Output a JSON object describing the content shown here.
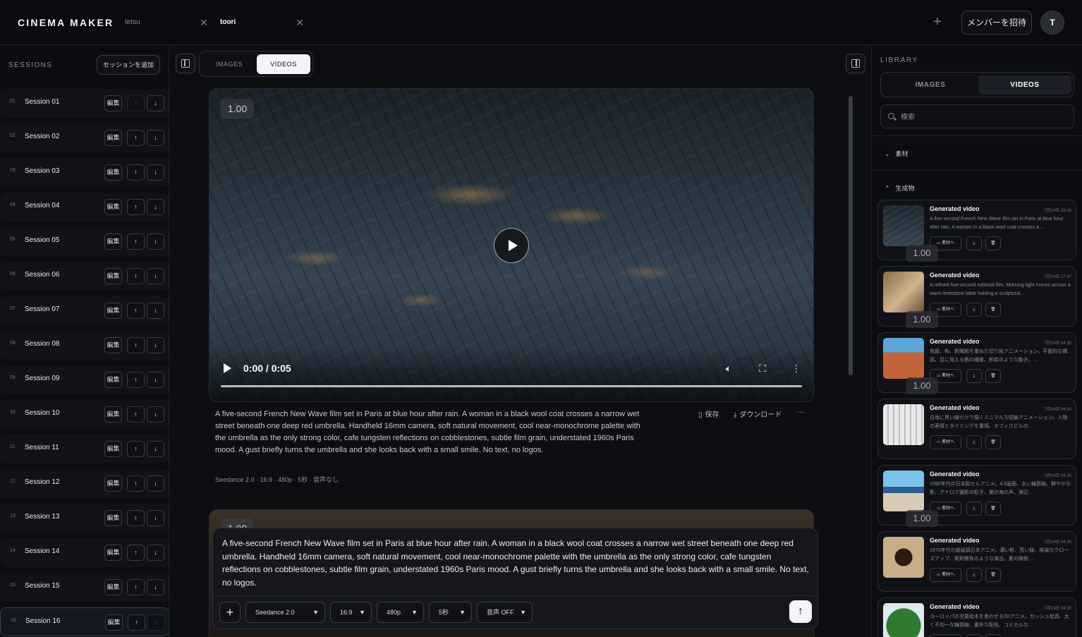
{
  "app": {
    "brand": "CINEMA MAKER",
    "tabs": [
      {
        "label": "tetsu"
      },
      {
        "label": "toori"
      }
    ],
    "invite_label": "メンバーを招待",
    "avatar_initial": "T"
  },
  "sessions": {
    "title": "SESSIONS",
    "add_label": "セッションを追加",
    "edit_label": "編集",
    "up_label": "↑",
    "down_label": "↓",
    "items": [
      {
        "num": "01",
        "name": "Session 01"
      },
      {
        "num": "02",
        "name": "Session 02"
      },
      {
        "num": "03",
        "name": "Session 03"
      },
      {
        "num": "04",
        "name": "Session 04"
      },
      {
        "num": "05",
        "name": "Session 05"
      },
      {
        "num": "06",
        "name": "Session 06"
      },
      {
        "num": "07",
        "name": "Session 07"
      },
      {
        "num": "08",
        "name": "Session 08"
      },
      {
        "num": "09",
        "name": "Session 09"
      },
      {
        "num": "10",
        "name": "Session 10"
      },
      {
        "num": "11",
        "name": "Session 11"
      },
      {
        "num": "12",
        "name": "Session 12"
      },
      {
        "num": "13",
        "name": "Session 13"
      },
      {
        "num": "14",
        "name": "Session 14"
      },
      {
        "num": "15",
        "name": "Session 15"
      },
      {
        "num": "16",
        "name": "Session 16"
      }
    ]
  },
  "main": {
    "view_tabs": {
      "images": "IMAGES",
      "videos": "VIDEOS"
    },
    "video1": {
      "badge": "1.00",
      "time": "0:00 / 0:05",
      "description": "A five-second French New Wave film set in Paris at blue hour after rain. A woman in a black wool coat crosses a narrow wet street beneath one deep red umbrella. Handheld 16mm camera, soft natural movement, cool near-monochrome palette with the umbrella as the only strong color, cafe tungsten reflections on cobblestones, subtle film grain, understated 1960s Paris mood. A gust briefly turns the umbrella and she looks back with a small smile. No text, no logos.",
      "meta": "Seedance 2.0 · 16:9 · 480p · 5秒 · 音声なし",
      "save_label": "保存",
      "download_label": "ダウンロード",
      "more_label": "···"
    },
    "video2": {
      "badge": "1.00"
    },
    "composer": {
      "text": "A five-second French New Wave film set in Paris at blue hour after rain. A woman in a black wool coat crosses a narrow wet street beneath one deep red umbrella. Handheld 16mm camera, soft natural movement, cool near-monochrome palette with the umbrella as the only strong color, cafe tungsten reflections on cobblestones, subtle film grain, understated 1960s Paris mood. A gust briefly turns the umbrella and she looks back with a small smile. No text, no logos.",
      "model": "Seedance 2.0",
      "ratio": "16:9",
      "resolution": "480p",
      "duration": "5秒",
      "audio": "音声 OFF"
    }
  },
  "library": {
    "title": "LIBRARY",
    "tabs": {
      "images": "IMAGES",
      "videos": "VIDEOS"
    },
    "search_placeholder": "検索",
    "section_material": "素材",
    "section_generated": "生成物",
    "to_material_label": "素材へ",
    "items": [
      {
        "title": "Generated video",
        "date": "7月24日 18:16",
        "desc": "A five-second French New Wave film set in Paris at blue hour after rain. A woman in a black wool coat crosses a…",
        "badge": "1.00",
        "thumb": "street"
      },
      {
        "title": "Generated video",
        "date": "7月24日 17:47",
        "desc": "A refined five-second editorial film. Morning light moves across a warm limestone table holding a sculptural…",
        "badge": "1.00",
        "thumb": "table"
      },
      {
        "title": "Generated video",
        "date": "7月24日 04:30",
        "desc": "色紙、布、新聞紙を重ねた切り絵アニメーション。平面的な構図、目に見える紙の繊維、影絵のような動き。…",
        "badge": "1.00",
        "thumb": "roof"
      },
      {
        "title": "Generated video",
        "date": "7月24日 04:30",
        "desc": "白地に黒い線だけで描くミニマルな短編アニメーション。人物の表情とタイミングを重視。オフィスビルの…",
        "badge": "",
        "thumb": "corridor"
      },
      {
        "title": "Generated video",
        "date": "7月24日 04:30",
        "desc": "1990年代の日本製セルアニメ。4:3画面、太い輪郭線、鮮やかな影、アナログ撮影の粒子、夏の海の声。海辺…",
        "badge": "1.00",
        "thumb": "sea"
      },
      {
        "title": "Generated video",
        "date": "7月24日 04:30",
        "desc": "1970年代の劇画調日本アニメ。濃い影、荒い線、極端なクローズアップ、真剣勝負のような演出。夏の縁側…",
        "badge": "",
        "thumb": "spider"
      },
      {
        "title": "Generated video",
        "date": "7月24日 04:30",
        "desc": "ヨーロッパの児童絵本を思わせる2Dアニメ。ガッシュ絵具、太く不均一な輪郭線、素朴な配色、コミカルな…",
        "badge": "",
        "thumb": "melon"
      }
    ]
  }
}
